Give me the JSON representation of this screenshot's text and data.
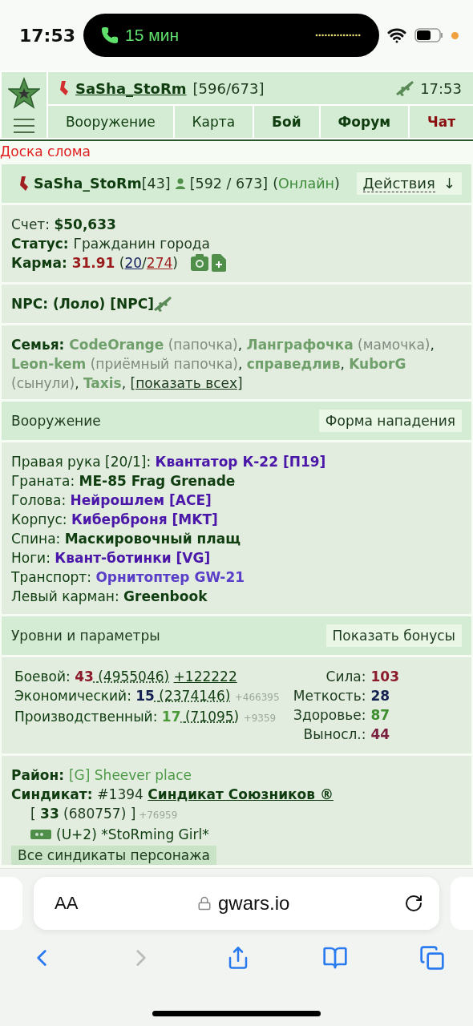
{
  "status_bar": {
    "time": "17:53",
    "call": "15 мин"
  },
  "header": {
    "player": "SaSha_StoRm",
    "hp": "[596/673]",
    "time": "17:53",
    "tabs": [
      {
        "label": "Вооружение",
        "kind": "normal"
      },
      {
        "label": "Карта",
        "kind": "normal"
      },
      {
        "label": "Бой",
        "kind": "bold"
      },
      {
        "label": "Форум",
        "kind": "bold"
      },
      {
        "label": "Чат",
        "kind": "alert"
      }
    ]
  },
  "notice": "Доска слома",
  "profile": {
    "name": "SaSha_StoRm",
    "level": "[43]",
    "hp": "[592 / 673]",
    "status": [
      {
        "text": "(",
        "kind": "plain"
      },
      {
        "text": "Онлайн",
        "kind": "online"
      },
      {
        "text": ")",
        "kind": "plain"
      }
    ],
    "actions": "Действия",
    "actions_arrow": "↓"
  },
  "sections": [
    {
      "kind": "account",
      "lines": [
        [
          {
            "text": "Счет: ",
            "kind": "plain"
          },
          {
            "text": "$50,633",
            "kind": "value"
          }
        ],
        [
          {
            "text": "Статус: ",
            "kind": "label"
          },
          {
            "text": "Гражданин города",
            "kind": "plain"
          }
        ],
        [
          {
            "text": "Карма: ",
            "kind": "label"
          },
          {
            "text": "31.91",
            "kind": "red"
          },
          {
            "text": " (",
            "kind": "plain"
          },
          {
            "text": "20",
            "kind": "navy",
            "link": true
          },
          {
            "text": "/",
            "kind": "plain"
          },
          {
            "text": "274",
            "kind": "darkred",
            "link": true
          },
          {
            "text": ")",
            "kind": "plain"
          }
        ]
      ]
    },
    {
      "kind": "npc",
      "lines": [
        [
          {
            "text": "NPC: (Лоло) [NPC]",
            "kind": "label"
          }
        ]
      ]
    },
    {
      "kind": "family",
      "lines": [
        [
          {
            "text": "Семья: ",
            "kind": "label"
          },
          {
            "text": "CodeOrange",
            "kind": "family"
          },
          {
            "text": " (папочка)",
            "kind": "muted"
          },
          {
            "text": ", ",
            "kind": "plain"
          },
          {
            "text": "Ланграфочка",
            "kind": "family"
          },
          {
            "text": " (мамочка)",
            "kind": "muted"
          },
          {
            "text": ", ",
            "kind": "plain"
          },
          {
            "text": "Leon-kem",
            "kind": "family"
          },
          {
            "text": " (приёмный папочка)",
            "kind": "muted"
          },
          {
            "text": ", ",
            "kind": "plain"
          },
          {
            "text": "справедлив",
            "kind": "family"
          },
          {
            "text": ", ",
            "kind": "plain"
          },
          {
            "text": "KuborG",
            "kind": "family"
          },
          {
            "text": " (сынули)",
            "kind": "muted"
          },
          {
            "text": ", ",
            "kind": "plain"
          },
          {
            "text": "Taxis",
            "kind": "family"
          },
          {
            "text": ", ",
            "kind": "plain"
          },
          {
            "text": "[показать всех]",
            "kind": "plain",
            "link": true
          }
        ]
      ]
    },
    {
      "kind": "panel",
      "title": "Вооружение",
      "button": "Форма нападения"
    },
    {
      "kind": "equipment",
      "items": [
        {
          "slot": "Правая рука [20/1]:",
          "item": "Квантатор К-22 [П19]",
          "color": "#4a17a8"
        },
        {
          "slot": "Граната:",
          "item": "ME-85 Frag Grenade",
          "color": "#0f3d0f"
        },
        {
          "slot": "Голова:",
          "item": "Нейрошлем [ACE]",
          "color": "#4a17a8"
        },
        {
          "slot": "Корпус:",
          "item": "Киберброня [MKT]",
          "color": "#4a17a8"
        },
        {
          "slot": "Спина:",
          "item": "Маскировочный плащ",
          "color": "#0f3d0f"
        },
        {
          "slot": "Ноги:",
          "item": "Квант-ботинки [VG]",
          "color": "#4a17a8"
        },
        {
          "slot": "Транспорт:",
          "item": "Орнитоптер GW-21",
          "color": "#5a3ec8"
        },
        {
          "slot": "Левый карман:",
          "item": "Greenbook",
          "color": "#0f3d0f"
        }
      ]
    },
    {
      "kind": "panel",
      "title": "Уровни и параметры",
      "button": "Показать бонусы"
    },
    {
      "kind": "levels",
      "skills": [
        {
          "name": "Боевой:",
          "level": "43",
          "exp": "(4955046)",
          "gain": "+122222",
          "kind": "link",
          "color": "#8b1a2b"
        },
        {
          "name": "Экономический:",
          "level": "15",
          "exp": "(2374146)",
          "gain": "+466395",
          "kind": "note",
          "color": "#14204f"
        },
        {
          "name": "Производственный:",
          "level": "17",
          "exp": "(71095)",
          "gain": "+9359",
          "kind": "note",
          "color": "#4a9a3a"
        }
      ],
      "stats": [
        {
          "name": "Сила:",
          "value": "103",
          "color": "#8b1a2b"
        },
        {
          "name": "Меткость:",
          "value": "28",
          "color": "#14204f"
        },
        {
          "name": "Здоровье:",
          "value": "87",
          "color": "#3e8e2e"
        },
        {
          "name": "Выносл.:",
          "value": "44",
          "color": "#7a1f3d"
        }
      ]
    },
    {
      "kind": "syndicate",
      "lines": [
        [
          {
            "text": "Район: ",
            "kind": "label"
          },
          {
            "text": "[G] Sheever place",
            "kind": "greentext"
          }
        ],
        [
          {
            "text": "Синдикат: ",
            "kind": "label"
          },
          {
            "text": "#1394 ",
            "kind": "plain"
          },
          {
            "text": "Синдикат Союзников ®",
            "kind": "label",
            "link": true
          }
        ]
      ],
      "level_line": [
        {
          "text": "[ ",
          "kind": "plain"
        },
        {
          "text": "33",
          "kind": "value"
        },
        {
          "text": " (680757) ]",
          "kind": "plain"
        },
        {
          "text": " +76959",
          "kind": "faded"
        }
      ],
      "rank": "(U+2) *StoRming Girl*",
      "button": "Все синдикаты персонажа"
    }
  ],
  "browser": {
    "text_size": "AA",
    "address": "gwars.io"
  }
}
